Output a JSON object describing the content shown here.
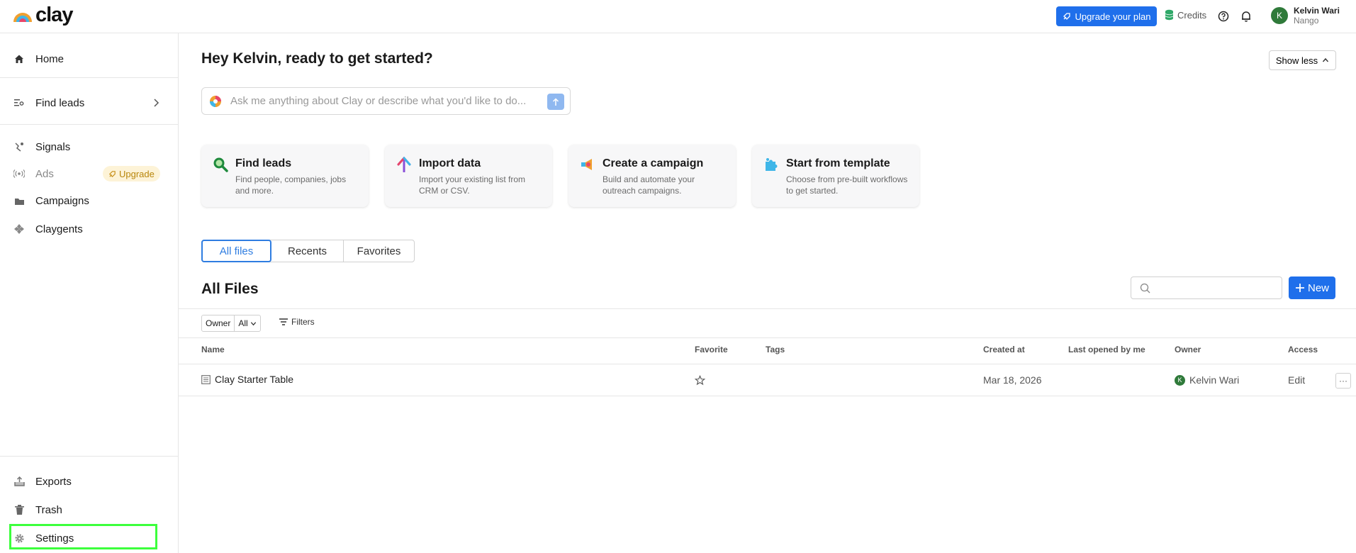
{
  "brand": {
    "name": "clay"
  },
  "header": {
    "upgrade_label": "Upgrade your plan",
    "credits_label": "Credits",
    "user": {
      "name": "Kelvin Wari",
      "org": "Nango",
      "initial": "K"
    }
  },
  "sidebar": {
    "home": "Home",
    "find_leads": "Find leads",
    "signals": "Signals",
    "ads": "Ads",
    "ads_badge": "Upgrade",
    "campaigns": "Campaigns",
    "claygents": "Claygents",
    "exports": "Exports",
    "trash": "Trash",
    "settings": "Settings"
  },
  "main": {
    "greeting": "Hey Kelvin, ready to get started?",
    "show_less": "Show less",
    "ask_placeholder": "Ask me anything about Clay or describe what you'd like to do...",
    "cards": [
      {
        "title": "Find leads",
        "desc": "Find people, companies, jobs and more.",
        "icon": "magnifier-icon"
      },
      {
        "title": "Import data",
        "desc": "Import your existing list from CRM or CSV.",
        "icon": "import-arrow-icon"
      },
      {
        "title": "Create a campaign",
        "desc": "Build and automate your outreach campaigns.",
        "icon": "megaphone-icon"
      },
      {
        "title": "Start from template",
        "desc": "Choose from pre-built workflows to get started.",
        "icon": "puzzle-icon"
      }
    ],
    "tabs": [
      "All files",
      "Recents",
      "Favorites"
    ],
    "files_title": "All Files",
    "new_label": "New",
    "filter": {
      "owner_label": "Owner",
      "owner_value": "All",
      "filters_label": "Filters"
    },
    "columns": [
      "Name",
      "Favorite",
      "Tags",
      "Created at",
      "Last opened by me",
      "Owner",
      "Access"
    ],
    "rows": [
      {
        "name": "Clay Starter Table",
        "created": "Mar 18, 2026",
        "owner": "Kelvin Wari",
        "owner_initial": "K",
        "access": "Edit",
        "more": "···"
      }
    ]
  },
  "colors": {
    "primary": "#1f6feb",
    "highlight": "#3cff3c",
    "avatar": "#2f7a3a"
  }
}
